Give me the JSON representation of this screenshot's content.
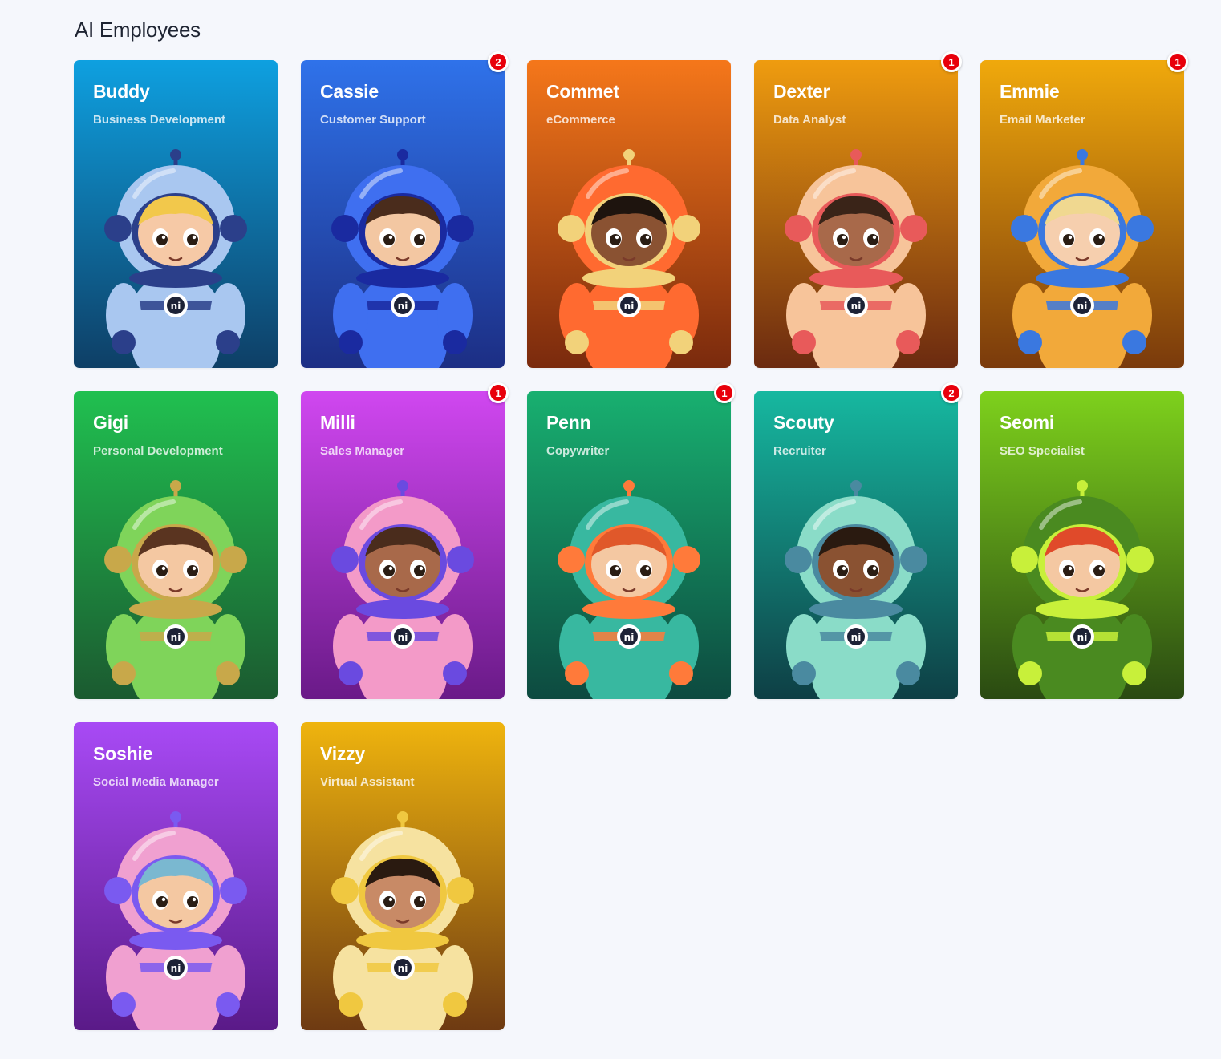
{
  "page": {
    "title": "AI Employees"
  },
  "employees": [
    {
      "name": "Buddy",
      "role": "Business Development",
      "badge": "",
      "colors": {
        "top": "#0ea0e0",
        "bottom": "#0e3f66",
        "suit": "#a9c7f0",
        "trim": "#2b3f8a",
        "hair": "#f2c84b",
        "skin": "#f6c9a6"
      }
    },
    {
      "name": "Cassie",
      "role": "Customer Support",
      "badge": "2",
      "colors": {
        "top": "#2f72ea",
        "bottom": "#1c2e84",
        "suit": "#3f6ff0",
        "trim": "#1a2aa0",
        "hair": "#4a2c1c",
        "skin": "#f3c7a2"
      }
    },
    {
      "name": "Commet",
      "role": "eCommerce",
      "badge": "",
      "colors": {
        "top": "#f5771a",
        "bottom": "#7a2a0d",
        "suit": "#ff6a30",
        "trim": "#f2d27a",
        "hair": "#1e140e",
        "skin": "#8a5232"
      }
    },
    {
      "name": "Dexter",
      "role": "Data Analyst",
      "badge": "1",
      "colors": {
        "top": "#ef9c0f",
        "bottom": "#6b2a10",
        "suit": "#f7c49a",
        "trim": "#e85a5a",
        "hair": "#3a2418",
        "skin": "#a8694a"
      }
    },
    {
      "name": "Emmie",
      "role": "Email Marketer",
      "badge": "1",
      "colors": {
        "top": "#f0a90c",
        "bottom": "#7a3a0c",
        "suit": "#f2a93a",
        "trim": "#3a78e0",
        "hair": "#f0d890",
        "skin": "#f6cfae"
      }
    },
    {
      "name": "Gigi",
      "role": "Personal Development",
      "badge": "",
      "colors": {
        "top": "#20c050",
        "bottom": "#1b5a30",
        "suit": "#7fd45a",
        "trim": "#c8a84a",
        "hair": "#5a3420",
        "skin": "#f4c8a2"
      }
    },
    {
      "name": "Milli",
      "role": "Sales Manager",
      "badge": "1",
      "colors": {
        "top": "#d047f0",
        "bottom": "#6a1a88",
        "suit": "#f39ac8",
        "trim": "#6a4ae0",
        "hair": "#4a2c1c",
        "skin": "#a8694a"
      }
    },
    {
      "name": "Penn",
      "role": "Copywriter",
      "badge": "1",
      "colors": {
        "top": "#18b070",
        "bottom": "#0d4a40",
        "suit": "#38b8a0",
        "trim": "#ff7a3a",
        "hair": "#e0582a",
        "skin": "#f4c8a2"
      }
    },
    {
      "name": "Scouty",
      "role": "Recruiter",
      "badge": "2",
      "colors": {
        "top": "#16b8a0",
        "bottom": "#0e3f45",
        "suit": "#8adcc8",
        "trim": "#4a8aa0",
        "hair": "#2a1a10",
        "skin": "#8a5232"
      }
    },
    {
      "name": "Seomi",
      "role": "SEO Specialist",
      "badge": "",
      "colors": {
        "top": "#7ed11c",
        "bottom": "#2a4a12",
        "suit": "#4a8a20",
        "trim": "#c8f03a",
        "hair": "#e04a2a",
        "skin": "#f4c8a2"
      }
    },
    {
      "name": "Soshie",
      "role": "Social Media Manager",
      "badge": "",
      "colors": {
        "top": "#a84af5",
        "bottom": "#5a1a88",
        "suit": "#f0a0d0",
        "trim": "#7a5af0",
        "hair": "#7ab8d0",
        "skin": "#f4c8a2"
      }
    },
    {
      "name": "Vizzy",
      "role": "Virtual Assistant",
      "badge": "",
      "colors": {
        "top": "#efb40e",
        "bottom": "#6e3a12",
        "suit": "#f6e2a0",
        "trim": "#f0c840",
        "hair": "#2a1a10",
        "skin": "#c88a66"
      }
    }
  ]
}
